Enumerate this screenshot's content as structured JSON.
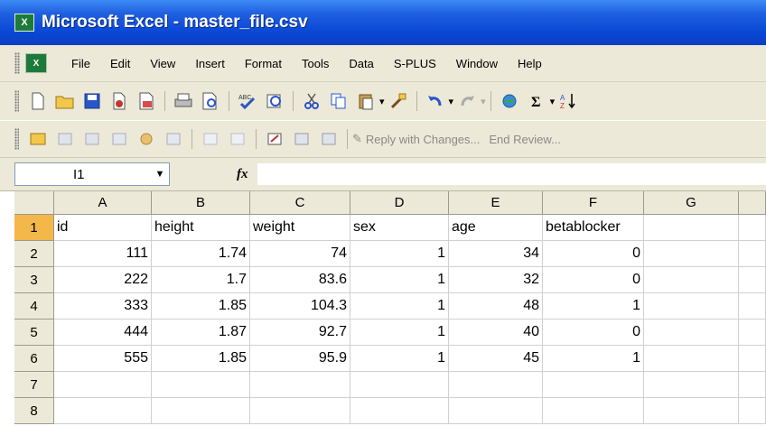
{
  "window": {
    "title": "Microsoft Excel - master_file.csv"
  },
  "menu": [
    "File",
    "Edit",
    "View",
    "Insert",
    "Format",
    "Tools",
    "Data",
    "S-PLUS",
    "Window",
    "Help"
  ],
  "toolbar1": {
    "icons": [
      "new-icon",
      "open-icon",
      "save-icon",
      "permission-icon",
      "email-icon",
      "print-icon",
      "print-preview-icon",
      "spelling-icon",
      "research-icon",
      "cut-icon",
      "copy-icon",
      "paste-icon",
      "format-painter-icon",
      "undo-icon",
      "redo-icon",
      "hyperlink-icon",
      "autosum-icon",
      "sort-ascending-icon"
    ]
  },
  "toolbar2": {
    "icons": [
      "review-icon-1",
      "review-icon-2",
      "review-icon-3",
      "review-icon-4",
      "review-icon-5",
      "review-icon-6",
      "review-icon-7",
      "review-icon-8",
      "review-icon-9",
      "review-icon-10",
      "review-icon-11"
    ],
    "reply_label": "Reply with Changes...",
    "end_review_label": "End Review..."
  },
  "formula_bar": {
    "name_box": "I1",
    "fx": "fx",
    "content": ""
  },
  "sheet": {
    "columns": [
      "A",
      "B",
      "C",
      "D",
      "E",
      "F",
      "G"
    ],
    "rows": [
      "1",
      "2",
      "3",
      "4",
      "5",
      "6",
      "7",
      "8"
    ],
    "active_row": "1",
    "cells": [
      [
        "id",
        "height",
        "weight",
        "sex",
        "age",
        "betablocker",
        ""
      ],
      [
        "111",
        "1.74",
        "74",
        "1",
        "34",
        "0",
        ""
      ],
      [
        "222",
        "1.7",
        "83.6",
        "1",
        "32",
        "0",
        ""
      ],
      [
        "333",
        "1.85",
        "104.3",
        "1",
        "48",
        "1",
        ""
      ],
      [
        "444",
        "1.87",
        "92.7",
        "1",
        "40",
        "0",
        ""
      ],
      [
        "555",
        "1.85",
        "95.9",
        "1",
        "45",
        "1",
        ""
      ],
      [
        "",
        "",
        "",
        "",
        "",
        "",
        ""
      ],
      [
        "",
        "",
        "",
        "",
        "",
        "",
        ""
      ]
    ]
  },
  "colors": {
    "titlebar": "#0a48d6",
    "chrome": "#ece9d8",
    "active_row_header": "#f4b74a"
  }
}
